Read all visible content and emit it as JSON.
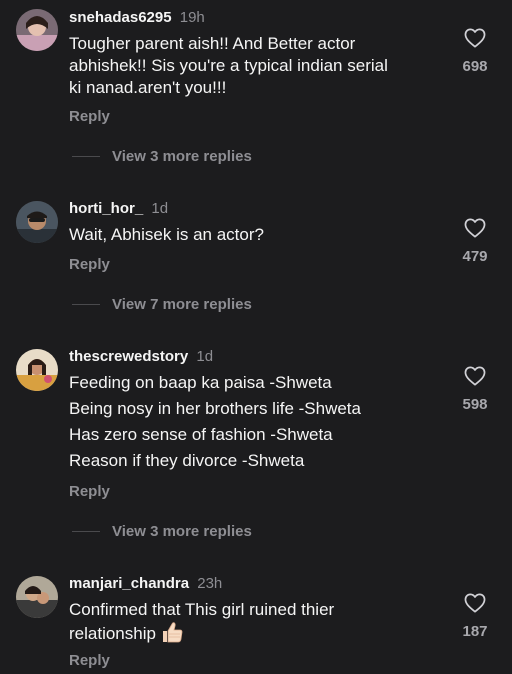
{
  "comments": [
    {
      "username": "snehadas6295",
      "time": "19h",
      "lines": [
        "Tougher parent aish!! And Better actor",
        "abhishek!! Sis you're a typical indian serial",
        "ki nanad.aren't you!!!"
      ],
      "likes": "698",
      "reply_label": "Reply",
      "more_replies": "View 3 more replies"
    },
    {
      "username": "horti_hor_",
      "time": "1d",
      "lines": [
        "Wait, Abhisek is an actor?"
      ],
      "likes": "479",
      "reply_label": "Reply",
      "more_replies": "View 7 more replies"
    },
    {
      "username": "thescrewedstory",
      "time": "1d",
      "lines": [
        "Feeding on baap ka paisa -Shweta",
        "Being nosy in her brothers life -Shweta",
        "Has zero sense of fashion -Shweta",
        "Reason if they divorce -Shweta"
      ],
      "likes": "598",
      "reply_label": "Reply",
      "more_replies": "View 3 more replies"
    },
    {
      "username": "manjari_chandra",
      "time": "23h",
      "lines": [
        "Confirmed that This girl ruined thier",
        "relationship"
      ],
      "likes": "187",
      "reply_label": "Reply",
      "emoji": "thumbs-up-emoji"
    }
  ],
  "colors": {
    "background": "#1c1c1e",
    "text": "#f5f5f5",
    "muted": "#8e8e93"
  },
  "icons": {
    "like": "heart-outline-icon"
  }
}
